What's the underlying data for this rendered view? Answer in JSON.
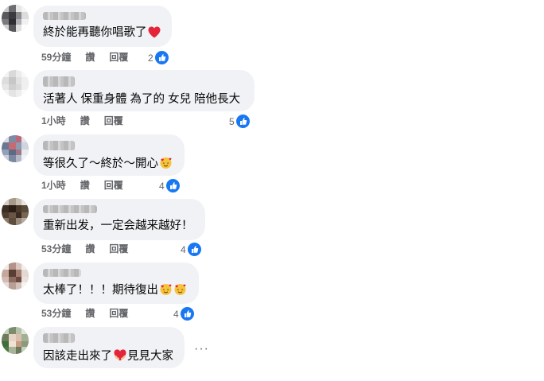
{
  "comments": [
    {
      "text": "終於能再聽你唱歌了",
      "emoji": "red-heart-icon",
      "time": "59分鐘",
      "like": "讚",
      "reply": "回覆",
      "reactions": "2"
    },
    {
      "text": "活著人 保重身體 為了的 女兒 陪他長大",
      "emoji": "",
      "time": "1小時",
      "like": "讚",
      "reply": "回覆",
      "reactions": "5"
    },
    {
      "text": "等很久了～終於～開心",
      "emoji": "smiling-face-with-hearts-icon",
      "time": "1小時",
      "like": "讚",
      "reply": "回覆",
      "reactions": "4"
    },
    {
      "text": "重新出发，一定会越来越好！",
      "emoji": "",
      "time": "53分鐘",
      "like": "讚",
      "reply": "回覆",
      "reactions": "4"
    },
    {
      "text": "太棒了！！！期待復出",
      "emoji": "smiling-face-with-hearts-icon",
      "time": "53分鐘",
      "like": "讚",
      "reply": "回覆",
      "reactions": "4"
    },
    {
      "text_before": "因該走出來了",
      "text_after": "見見大家",
      "emoji": "heart-with-hands-icon"
    }
  ],
  "more_label": "···",
  "colors": {
    "bubble": "#f0f2f5",
    "like_blue": "#1877f2",
    "meta_gray": "#65676b",
    "heart_red": "#e4243b"
  }
}
